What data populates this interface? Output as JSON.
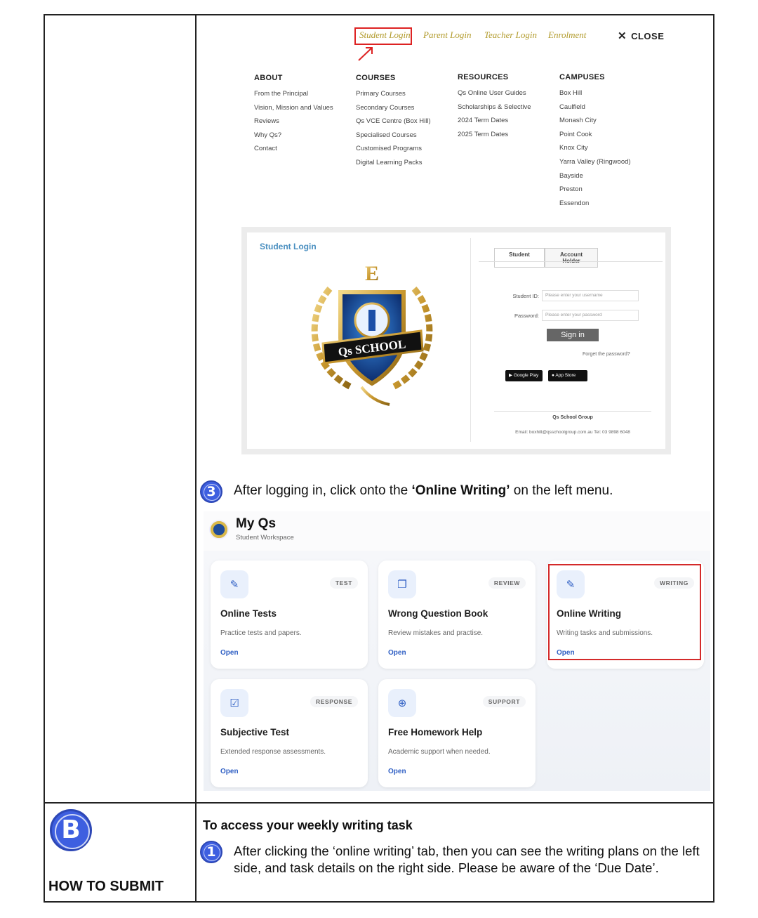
{
  "nav": {
    "student_login": "Student Login",
    "parent_login": "Parent Login",
    "teacher_login": "Teacher Login",
    "enrolment": "Enrolment",
    "close": "CLOSE"
  },
  "menu": {
    "about": {
      "heading": "ABOUT",
      "items": [
        "From the Principal",
        "Vision, Mission and Values",
        "Reviews",
        "Why Qs?",
        "Contact"
      ]
    },
    "courses": {
      "heading": "COURSES",
      "items": [
        "Primary Courses",
        "Secondary Courses",
        "Qs VCE Centre (Box Hill)",
        "Specialised Courses",
        "Customised Programs",
        "Digital Learning Packs"
      ]
    },
    "resources": {
      "heading": "RESOURCES",
      "items": [
        "Qs Online User Guides",
        "Scholarships & Selective",
        "2024 Term Dates",
        "2025 Term Dates"
      ]
    },
    "campuses": {
      "heading": "CAMPUSES",
      "items": [
        "Box Hill",
        "Caulfield",
        "Monash City",
        "Point Cook",
        "Knox City",
        "Yarra Valley (Ringwood)",
        "Bayside",
        "Preston",
        "Essendon"
      ]
    }
  },
  "login_panel": {
    "title": "Student Login",
    "crest_letter": "E",
    "crest_banner": "Qs SCHOOL",
    "tab_student": "Student",
    "tab_account": "Account Holder",
    "id_label": "Student ID:",
    "id_placeholder": "Please enter your username",
    "pw_label": "Password:",
    "pw_placeholder": "Please enter your password",
    "sign_in": "Sign in",
    "forgot": "Forget the password?",
    "google_play": "Google Play",
    "app_store": "App Store",
    "group": "Qs School Group",
    "contact": "Email:  boxhill@qsschoolgroup.com.au  Tel: 03 9898 6048"
  },
  "step3": {
    "number": "3",
    "before": "After logging in, click onto the ",
    "bold": "‘Online Writing’",
    "after": " on the left menu."
  },
  "dashboard": {
    "title": "My Qs",
    "subtitle": "Student Workspace",
    "cards": [
      {
        "tag": "TEST",
        "title": "Online Tests",
        "desc": "Practice tests and papers.",
        "open": "Open"
      },
      {
        "tag": "REVIEW",
        "title": "Wrong Question Book",
        "desc": "Review mistakes and practise.",
        "open": "Open"
      },
      {
        "tag": "WRITING",
        "title": "Online Writing",
        "desc": "Writing tasks and submissions.",
        "open": "Open"
      },
      {
        "tag": "RESPONSE",
        "title": "Subjective Test",
        "desc": "Extended response assessments.",
        "open": "Open"
      },
      {
        "tag": "SUPPORT",
        "title": "Free Homework Help",
        "desc": "Academic support when needed.",
        "open": "Open"
      }
    ]
  },
  "section_b": {
    "letter": "B",
    "label": "HOW TO SUBMIT",
    "heading": "To access your weekly writing task",
    "step_number": "1",
    "step_text": "After clicking the ‘online writing’ tab, then you can see the writing plans on the left side, and task details on the right side. Please be aware of the ‘Due Date’."
  },
  "colors": {
    "accent": "#3e5fe0",
    "highlight": "#d42a2a",
    "nav_gold": "#b19a2a",
    "link_blue": "#2f5fc4"
  }
}
